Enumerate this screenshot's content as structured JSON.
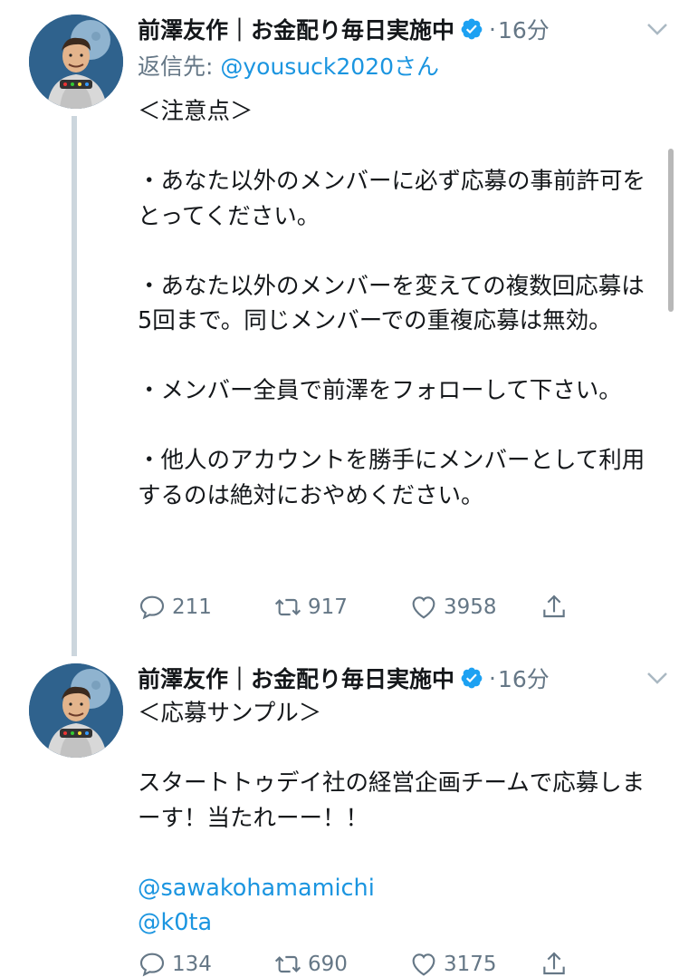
{
  "tweets": [
    {
      "author": "前澤友作｜お金配り毎日実施中",
      "dot": "·",
      "time": "16分",
      "replying_prefix": "返信先: ",
      "replying_handle": "@yousuck2020さん",
      "body": [
        "＜注意点＞",
        "",
        "・あなた以外のメンバーに必ず応募の事前許可をとってください。",
        "",
        "・あなた以外のメンバーを変えての複数回応募は5回まで。同じメンバーでの重複応募は無効。",
        "",
        "・メンバー全員で前澤をフォローして下さい。",
        "",
        "・他人のアカウントを勝手にメンバーとして利用するのは絶対におやめください。"
      ],
      "stats": {
        "replies": "211",
        "retweets": "917",
        "likes": "3958"
      }
    },
    {
      "author": "前澤友作｜お金配り毎日実施中",
      "dot": "·",
      "time": "16分",
      "body_lines": [
        "＜応募サンプル＞",
        "",
        "スタートトゥデイ社の経営企画チームで応募しまーす！当たれーー！！",
        ""
      ],
      "mentions": [
        "@sawakohamamichi",
        "@k0ta"
      ],
      "stats": {
        "replies": "134",
        "retweets": "690",
        "likes": "3175"
      }
    }
  ],
  "colors": {
    "link": "#1b95e0",
    "muted": "#657786",
    "verified": "#1da1f2",
    "thread": "#ccd6dd"
  },
  "icons": [
    "verified-badge-icon",
    "chevron-down-icon",
    "reply-icon",
    "retweet-icon",
    "like-icon",
    "share-icon"
  ]
}
